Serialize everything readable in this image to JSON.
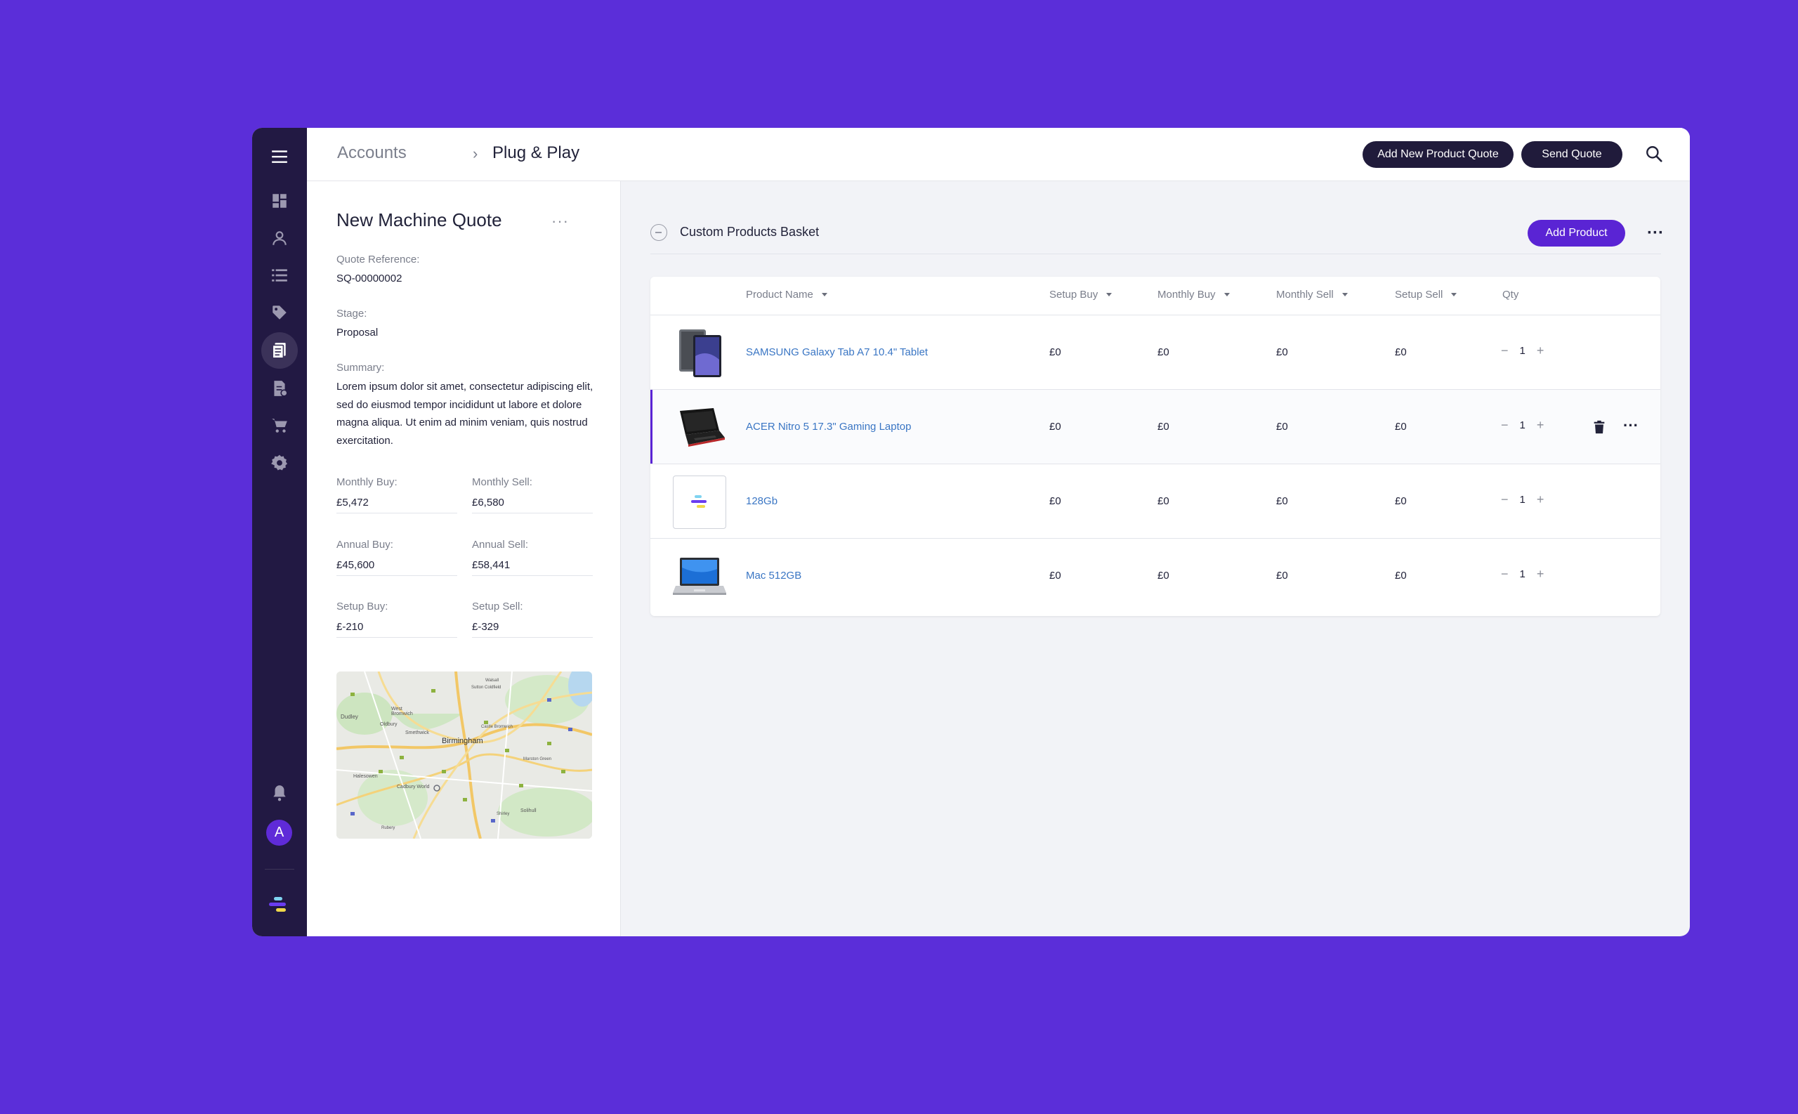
{
  "breadcrumb": {
    "root": "Accounts",
    "separator": "›",
    "current": "Plug & Play"
  },
  "toolbar": {
    "add_quote_label": "Add New Product Quote",
    "send_quote_label": "Send Quote"
  },
  "quote": {
    "title": "New Machine Quote",
    "more": "···",
    "reference_label": "Quote Reference:",
    "reference_value": "SQ-00000002",
    "stage_label": "Stage:",
    "stage_value": "Proposal",
    "summary_label": "Summary:",
    "summary_value": "Lorem ipsum dolor sit amet, consectetur adipiscing elit, sed do eiusmod tempor incididunt ut labore et dolore magna aliqua. Ut enim ad minim veniam, quis nostrud exercitation.",
    "metrics": [
      {
        "label": "Monthly Buy:",
        "value": "£5,472"
      },
      {
        "label": "Monthly Sell:",
        "value": "£6,580"
      },
      {
        "label": "Annual Buy:",
        "value": "£45,600"
      },
      {
        "label": "Annual Sell:",
        "value": "£58,441"
      },
      {
        "label": "Setup Buy:",
        "value": "£-210"
      },
      {
        "label": "Setup Sell:",
        "value": "£-329"
      }
    ]
  },
  "map": {
    "labels": [
      "Birmingham",
      "Dudley",
      "West Bromwich",
      "Smethwick",
      "Oldbury",
      "Halesowen",
      "Cadbury World",
      "Solihull",
      "Sutton Coldfield",
      "Walsall",
      "Marston Green",
      "Rubery",
      "Castle Bromwich",
      "Shirley"
    ]
  },
  "basket": {
    "title": "Custom Products Basket",
    "add_product_label": "Add Product",
    "more": "···",
    "columns": [
      "Product Name",
      "Setup Buy",
      "Monthly Buy",
      "Monthly Sell",
      "Setup Sell",
      "Qty"
    ],
    "rows": [
      {
        "name": "SAMSUNG Galaxy Tab A7 10.4\" Tablet",
        "setup_buy": "£0",
        "monthly_buy": "£0",
        "monthly_sell": "£0",
        "setup_sell": "£0",
        "qty": "1"
      },
      {
        "name": "ACER Nitro 5 17.3\" Gaming Laptop",
        "setup_buy": "£0",
        "monthly_buy": "£0",
        "monthly_sell": "£0",
        "setup_sell": "£0",
        "qty": "1"
      },
      {
        "name": "128Gb",
        "setup_buy": "£0",
        "monthly_buy": "£0",
        "monthly_sell": "£0",
        "setup_sell": "£0",
        "qty": "1"
      },
      {
        "name": "Mac 512GB",
        "setup_buy": "£0",
        "monthly_buy": "£0",
        "monthly_sell": "£0",
        "setup_sell": "£0",
        "qty": "1"
      }
    ],
    "qty_minus": "−",
    "qty_plus": "+",
    "row_more": "···"
  },
  "user": {
    "avatar_initial": "A"
  },
  "colors": {
    "brand_purple": "#5a24d4",
    "sidebar": "#221943",
    "link": "#3a76c4"
  }
}
